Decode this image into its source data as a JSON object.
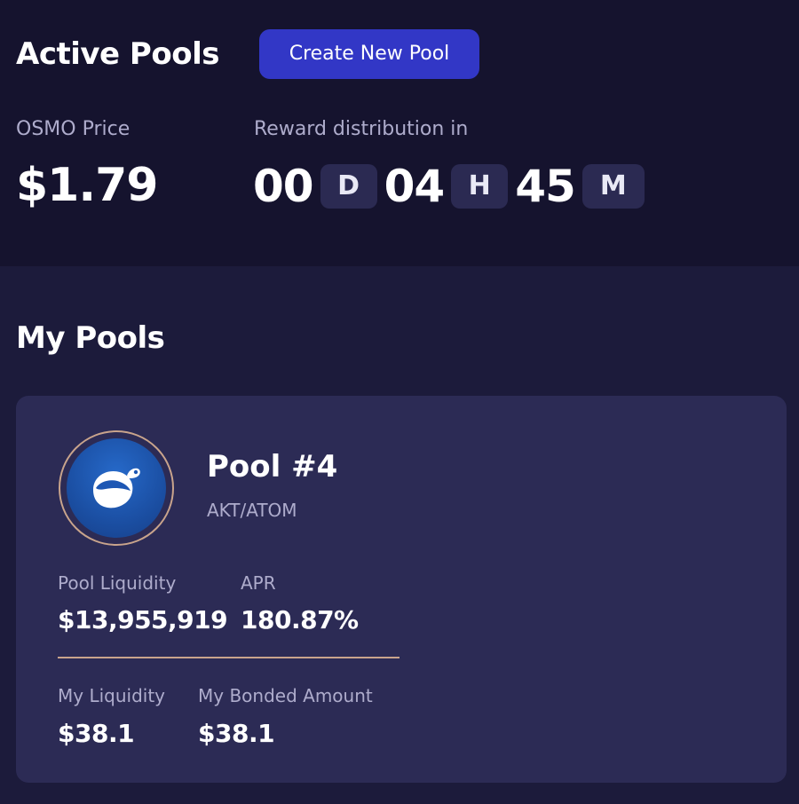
{
  "header": {
    "title": "Active Pools",
    "create_button_label": "Create New Pool"
  },
  "osmo_price": {
    "label": "OSMO Price",
    "value": "$1.79"
  },
  "reward": {
    "label": "Reward distribution in",
    "days": "00",
    "days_unit": "D",
    "hours": "04",
    "hours_unit": "H",
    "minutes": "45",
    "minutes_unit": "M"
  },
  "my_pools": {
    "title": "My Pools",
    "pools": [
      {
        "name": "Pool #4",
        "pair": "AKT/ATOM",
        "icon": "osmosis-icon",
        "liquidity_label": "Pool Liquidity",
        "liquidity_value": "$13,955,919",
        "apr_label": "APR",
        "apr_value": "180.87%",
        "my_liquidity_label": "My Liquidity",
        "my_liquidity_value": "$38.1",
        "my_bonded_label": "My Bonded Amount",
        "my_bonded_value": "$38.1"
      }
    ]
  },
  "colors": {
    "top_background": "#15132e",
    "page_background": "#1c1b3b",
    "card_background": "#2c2b55",
    "accent": "#3237c6",
    "divider": "#c9a48c"
  }
}
